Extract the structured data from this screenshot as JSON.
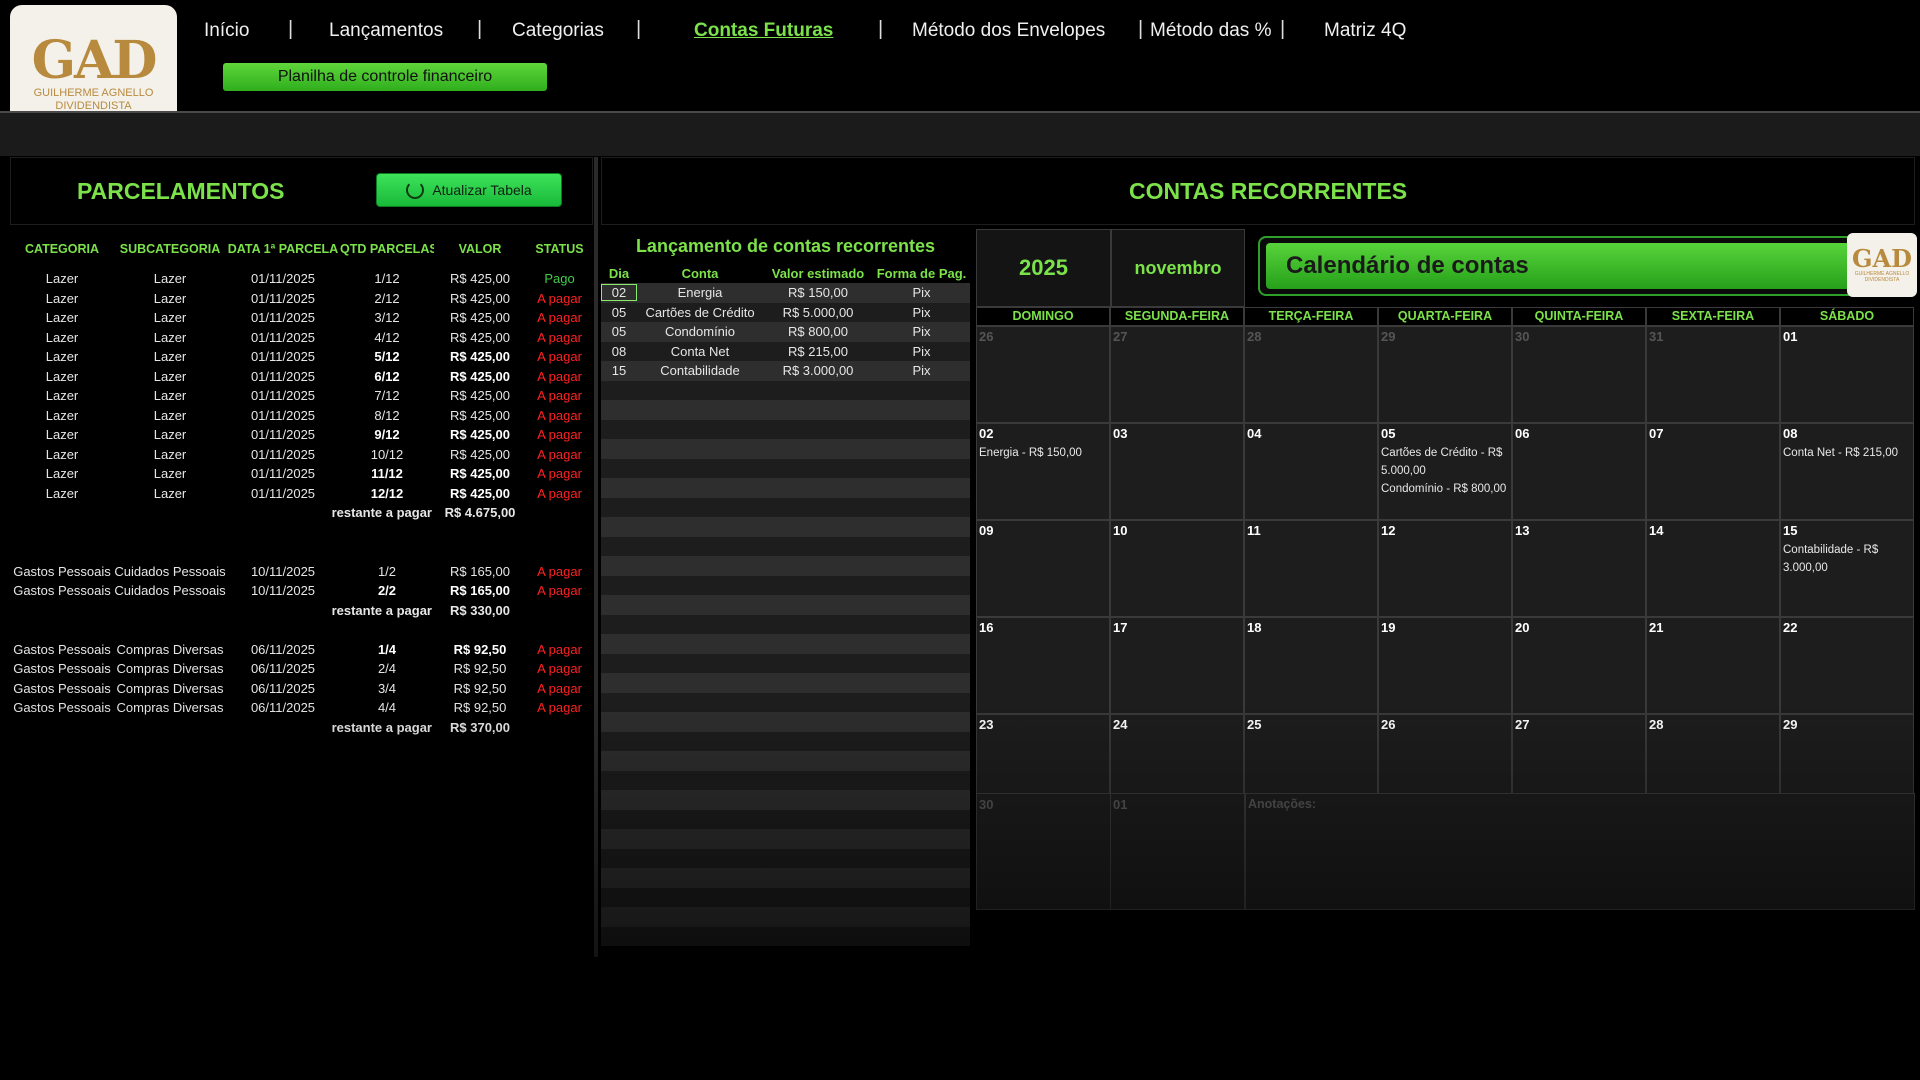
{
  "logo": {
    "mark_left": "G",
    "mark_mid": "A",
    "mark_right": "D",
    "line1": "GUILHERME AGNELLO",
    "line2": "DIVIDENDISTA"
  },
  "nav": {
    "items": [
      "Início",
      "Lançamentos",
      "Categorias",
      "Contas Futuras",
      "Método dos Envelopes",
      "Método das %",
      "Matriz 4Q"
    ],
    "active": "Contas Futuras"
  },
  "subtitle": "Planilha de controle financeiro",
  "left": {
    "title": "PARCELAMENTOS",
    "refresh_label": "Atualizar Tabela",
    "headers": [
      "CATEGORIA",
      "SUBCATEGORIA",
      "DATA 1ª PARCELA",
      "QTD PARCELAS",
      "VALOR",
      "STATUS"
    ],
    "rows": [
      [
        "Lazer",
        "Lazer",
        "01/11/2025",
        "1/12",
        "R$ 425,00",
        "Pago"
      ],
      [
        "Lazer",
        "Lazer",
        "01/11/2025",
        "2/12",
        "R$ 425,00",
        "A pagar"
      ],
      [
        "Lazer",
        "Lazer",
        "01/11/2025",
        "3/12",
        "R$ 425,00",
        "A pagar"
      ],
      [
        "Lazer",
        "Lazer",
        "01/11/2025",
        "4/12",
        "R$ 425,00",
        "A pagar"
      ],
      [
        "Lazer",
        "Lazer",
        "01/11/2025",
        "5/12",
        "R$ 425,00",
        "A pagar"
      ],
      [
        "Lazer",
        "Lazer",
        "01/11/2025",
        "6/12",
        "R$ 425,00",
        "A pagar"
      ],
      [
        "Lazer",
        "Lazer",
        "01/11/2025",
        "7/12",
        "R$ 425,00",
        "A pagar"
      ],
      [
        "Lazer",
        "Lazer",
        "01/11/2025",
        "8/12",
        "R$ 425,00",
        "A pagar"
      ],
      [
        "Lazer",
        "Lazer",
        "01/11/2025",
        "9/12",
        "R$ 425,00",
        "A pagar"
      ],
      [
        "Lazer",
        "Lazer",
        "01/11/2025",
        "10/12",
        "R$ 425,00",
        "A pagar"
      ],
      [
        "Lazer",
        "Lazer",
        "01/11/2025",
        "11/12",
        "R$ 425,00",
        "A pagar"
      ],
      [
        "Lazer",
        "Lazer",
        "01/11/2025",
        "12/12",
        "R$ 425,00",
        "A pagar"
      ],
      [
        "sub",
        "restante a pagar",
        "R$ 4.675,00"
      ],
      [
        "gap"
      ],
      [
        "gap"
      ],
      [
        "Gastos Pessoais",
        "Cuidados Pessoais",
        "10/11/2025",
        "1/2",
        "R$ 165,00",
        "A pagar"
      ],
      [
        "Gastos Pessoais",
        "Cuidados Pessoais",
        "10/11/2025",
        "2/2",
        "R$ 165,00",
        "A pagar"
      ],
      [
        "sub",
        "restante a pagar",
        "R$ 330,00"
      ],
      [
        "gap"
      ],
      [
        "Gastos Pessoais",
        "Compras Diversas",
        "06/11/2025",
        "1/4",
        "R$ 92,50",
        "A pagar"
      ],
      [
        "Gastos Pessoais",
        "Compras Diversas",
        "06/11/2025",
        "2/4",
        "R$ 92,50",
        "A pagar"
      ],
      [
        "Gastos Pessoais",
        "Compras Diversas",
        "06/11/2025",
        "3/4",
        "R$ 92,50",
        "A pagar"
      ],
      [
        "Gastos Pessoais",
        "Compras Diversas",
        "06/11/2025",
        "4/4",
        "R$ 92,50",
        "A pagar"
      ],
      [
        "sub",
        "restante a pagar",
        "R$ 370,00"
      ]
    ]
  },
  "right": {
    "title": "CONTAS RECORRENTES",
    "list_title": "Lançamento de contas recorrentes",
    "list_headers": [
      "Dia",
      "Conta",
      "Valor estimado",
      "Forma de Pag."
    ],
    "list_rows": [
      [
        "02",
        "Energia",
        "R$ 150,00",
        "Pix"
      ],
      [
        "05",
        "Cartões de Crédito",
        "R$ 5.000,00",
        "Pix"
      ],
      [
        "05",
        "Condomínio",
        "R$ 800,00",
        "Pix"
      ],
      [
        "08",
        "Conta Net",
        "R$ 215,00",
        "Pix"
      ],
      [
        "15",
        "Contabilidade",
        "R$ 3.000,00",
        "Pix"
      ],
      [
        "",
        "",
        "",
        ""
      ],
      [
        "",
        "",
        "",
        ""
      ],
      [
        "",
        "",
        "",
        ""
      ],
      [
        "",
        "",
        "",
        ""
      ],
      [
        "",
        "",
        "",
        ""
      ],
      [
        "",
        "",
        "",
        ""
      ],
      [
        "",
        "",
        "",
        ""
      ],
      [
        "",
        "",
        "",
        ""
      ],
      [
        "",
        "",
        "",
        ""
      ],
      [
        "",
        "",
        "",
        ""
      ],
      [
        "",
        "",
        "",
        ""
      ],
      [
        "",
        "",
        "",
        ""
      ],
      [
        "",
        "",
        "",
        ""
      ],
      [
        "",
        "",
        "",
        ""
      ],
      [
        "",
        "",
        "",
        ""
      ],
      [
        "",
        "",
        "",
        ""
      ],
      [
        "",
        "",
        "",
        ""
      ],
      [
        "",
        "",
        "",
        ""
      ],
      [
        "",
        "",
        "",
        ""
      ],
      [
        "",
        "",
        "",
        ""
      ],
      [
        "",
        "",
        "",
        ""
      ],
      [
        "",
        "",
        "",
        ""
      ],
      [
        "",
        "",
        "",
        ""
      ],
      [
        "",
        "",
        "",
        ""
      ],
      [
        "",
        "",
        "",
        ""
      ],
      [
        "",
        "",
        "",
        ""
      ],
      [
        "",
        "",
        "",
        ""
      ],
      [
        "",
        "",
        "",
        ""
      ],
      [
        "",
        "",
        "",
        ""
      ]
    ],
    "year": "2025",
    "month": "novembro",
    "calendar_title": "Calendário de contas",
    "weekdays": [
      "DOMINGO",
      "SEGUNDA-FEIRA",
      "TERÇA-FEIRA",
      "QUARTA-FEIRA",
      "QUINTA-FEIRA",
      "SEXTA-FEIRA",
      "SÁBADO"
    ],
    "weeks": [
      [
        {
          "d": "26",
          "out": true
        },
        {
          "d": "27",
          "out": true
        },
        {
          "d": "28",
          "out": true
        },
        {
          "d": "29",
          "out": true
        },
        {
          "d": "30",
          "out": true
        },
        {
          "d": "31",
          "out": true
        },
        {
          "d": "01"
        }
      ],
      [
        {
          "d": "02",
          "ev": [
            "Energia - R$ 150,00"
          ]
        },
        {
          "d": "03"
        },
        {
          "d": "04"
        },
        {
          "d": "05",
          "ev": [
            "Cartões de Crédito - R$ 5.000,00",
            "Condomínio - R$ 800,00"
          ]
        },
        {
          "d": "06"
        },
        {
          "d": "07"
        },
        {
          "d": "08",
          "ev": [
            "Conta Net - R$ 215,00"
          ]
        }
      ],
      [
        {
          "d": "09"
        },
        {
          "d": "10"
        },
        {
          "d": "11"
        },
        {
          "d": "12"
        },
        {
          "d": "13"
        },
        {
          "d": "14"
        },
        {
          "d": "15",
          "ev": [
            "Contabilidade - R$ 3.000,00"
          ]
        }
      ],
      [
        {
          "d": "16"
        },
        {
          "d": "17"
        },
        {
          "d": "18"
        },
        {
          "d": "19"
        },
        {
          "d": "20"
        },
        {
          "d": "21"
        },
        {
          "d": "22"
        }
      ],
      [
        {
          "d": "23"
        },
        {
          "d": "24"
        },
        {
          "d": "25"
        },
        {
          "d": "26"
        },
        {
          "d": "27"
        },
        {
          "d": "28"
        },
        {
          "d": "29"
        }
      ]
    ],
    "last_row": [
      {
        "d": "30"
      },
      {
        "d": "01",
        "out": true
      }
    ],
    "annotations_label": "Anotações:"
  },
  "colors": {
    "accent": "#7be24a",
    "status_paid": "#41c94a",
    "status_due": "#ff2020",
    "background": "#000000"
  }
}
